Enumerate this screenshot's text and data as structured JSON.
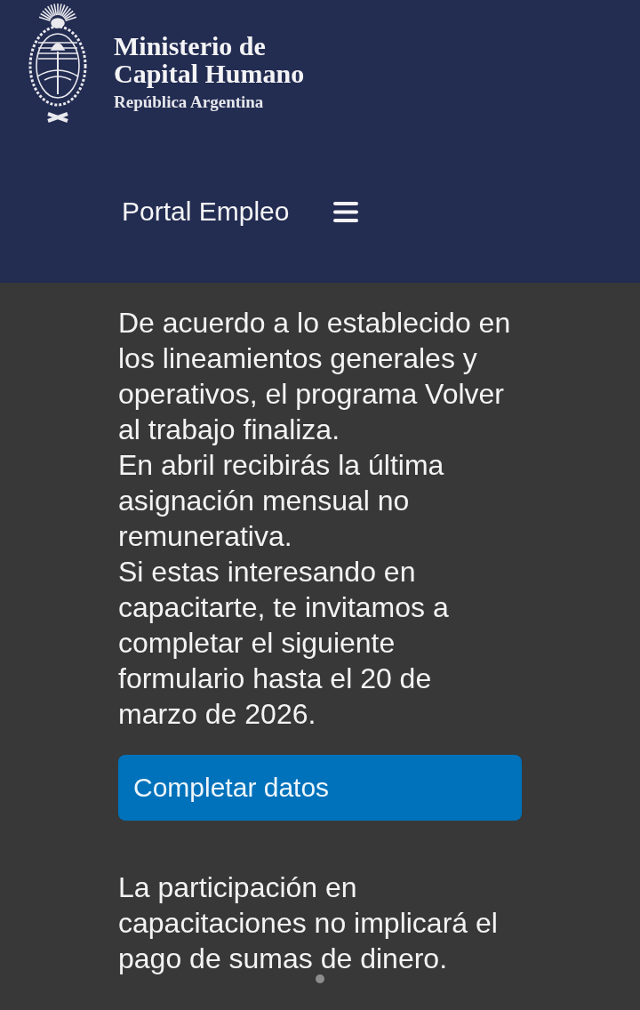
{
  "header": {
    "ministry": "Ministerio de Capital Humano",
    "country": "República Argentina"
  },
  "nav": {
    "title": "Portal Empleo"
  },
  "content": {
    "paragraphs": [
      "De acuerdo a lo establecido en los lineamientos generales y operativos, el programa Volver al trabajo finaliza.",
      "En abril recibirás la última asignación mensual no remunerativa.",
      "Si estas interesando en capacitarte, te invitamos a completar el siguiente formulario hasta el 20 de marzo de 2026."
    ],
    "button": "Completar datos",
    "note": "La participación en capacitaciones no implicará el pago de sumas de dinero."
  }
}
